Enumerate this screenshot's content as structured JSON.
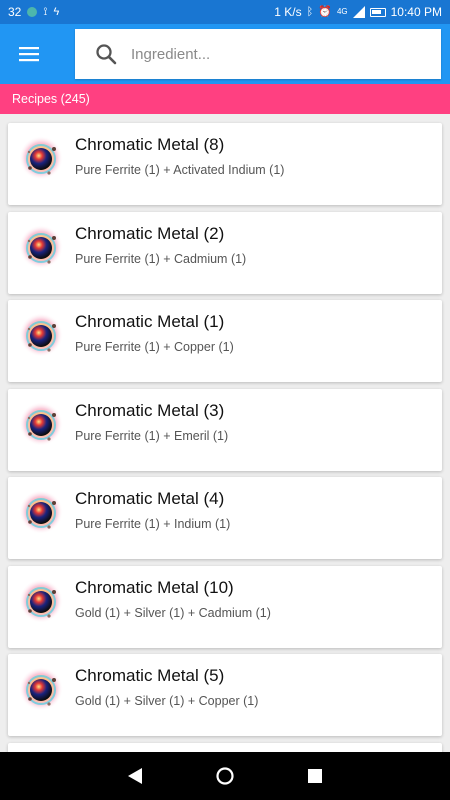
{
  "status_bar": {
    "left_text": "32",
    "net_speed": "1 K/s",
    "time": "10:40 PM",
    "network_label": "4G"
  },
  "app_bar": {
    "menu_icon": "menu-icon",
    "search": {
      "placeholder": "Ingredient...",
      "value": "",
      "icon": "search-icon"
    }
  },
  "count_bar": {
    "label": "Recipes (245)"
  },
  "recipes": [
    {
      "title": "Chromatic Metal (8)",
      "ingredients": "Pure Ferrite (1) + Activated Indium (1)"
    },
    {
      "title": "Chromatic Metal (2)",
      "ingredients": "Pure Ferrite (1) + Cadmium (1)"
    },
    {
      "title": "Chromatic Metal (1)",
      "ingredients": "Pure Ferrite (1) + Copper (1)"
    },
    {
      "title": "Chromatic Metal (3)",
      "ingredients": "Pure Ferrite (1) + Emeril (1)"
    },
    {
      "title": "Chromatic Metal (4)",
      "ingredients": "Pure Ferrite (1) + Indium (1)"
    },
    {
      "title": "Chromatic Metal (10)",
      "ingredients": "Gold (1) + Silver (1) + Cadmium (1)"
    },
    {
      "title": "Chromatic Metal (5)",
      "ingredients": "Gold (1) + Silver (1) + Copper (1)"
    }
  ],
  "colors": {
    "status_bar": "#1976d2",
    "app_bar": "#2196f3",
    "accent": "#ff4081"
  }
}
